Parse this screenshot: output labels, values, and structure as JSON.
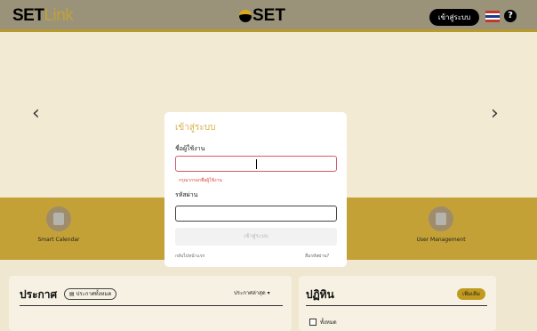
{
  "header": {
    "brand_set": "SET",
    "brand_link": "Link",
    "center_logo_text": "SET",
    "login_button": "เข้าสู่ระบบ",
    "help_label": "?"
  },
  "carousel": {
    "prev_arrow": "‹",
    "next_arrow": "›"
  },
  "features": [
    {
      "label": "Smart Calendar",
      "icon": "calendar-icon"
    },
    {
      "label": "User Management",
      "icon": "user-management-icon"
    }
  ],
  "announcements": {
    "title": "ประกาศ",
    "all_chip": "ประกาศทั้งหมด",
    "sort_label": "ประกาศล่าสุด"
  },
  "calendar_panel": {
    "title": "ปฏิทิน",
    "add_button": "เพิ่มเติม",
    "filter_all": "ทั้งหมด"
  },
  "login_modal": {
    "title": "เข้าสู่ระบบ",
    "username_label": "ชื่อผู้ใช้งาน",
    "username_value": "",
    "username_error": "กรุณากรอกชื่อผู้ใช้งาน",
    "password_label": "รหัสผ่าน",
    "password_value": "",
    "submit_label": "เข้าสู่ระบบ",
    "back_link": "กลับไปหน้าแรก",
    "forgot_link": "ลืมรหัสผ่าน?"
  },
  "colors": {
    "accent_gold": "#d8b04a",
    "band_gold": "#c4a136",
    "error_red": "#d65a6a"
  }
}
